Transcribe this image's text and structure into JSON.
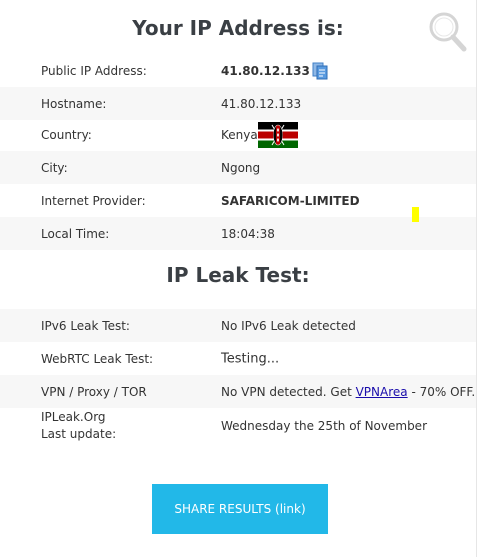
{
  "ip_section": {
    "title": "Your IP Address is:",
    "rows": [
      {
        "label": "Public IP Address:",
        "value": "41.80.12.133"
      },
      {
        "label": "Hostname:",
        "value": "41.80.12.133"
      },
      {
        "label": "Country:",
        "value": "Kenya"
      },
      {
        "label": "City:",
        "value": "Ngong"
      },
      {
        "label": "Internet Provider:",
        "value": "SAFARICOM-LIMITED"
      },
      {
        "label": "Local Time:",
        "value": "18:04:38"
      }
    ]
  },
  "leak_section": {
    "title": "IP Leak Test:",
    "ipv6": {
      "label": "IPv6 Leak Test:",
      "value": "No IPv6 Leak detected"
    },
    "webrtc": {
      "label": "WebRTC Leak Test:",
      "value": "Testing..."
    },
    "vpn": {
      "label": "VPN / Proxy / TOR",
      "value_before": "No VPN detected. Get ",
      "link": "VPNArea",
      "value_after": " - 70% OFF."
    },
    "update": {
      "label_line1": "IPLeak.Org",
      "label_line2": "Last update:",
      "value": "Wednesday the 25th of November"
    }
  },
  "share_button": {
    "label": "SHARE RESULTS (link)"
  },
  "icons": {
    "copy": "copy-icon",
    "search": "search-icon",
    "flag": "kenya-flag-icon"
  },
  "colors": {
    "accent": "#22b8e8",
    "row_shade": "#f7f7f7",
    "highlight": "#ffff00"
  }
}
